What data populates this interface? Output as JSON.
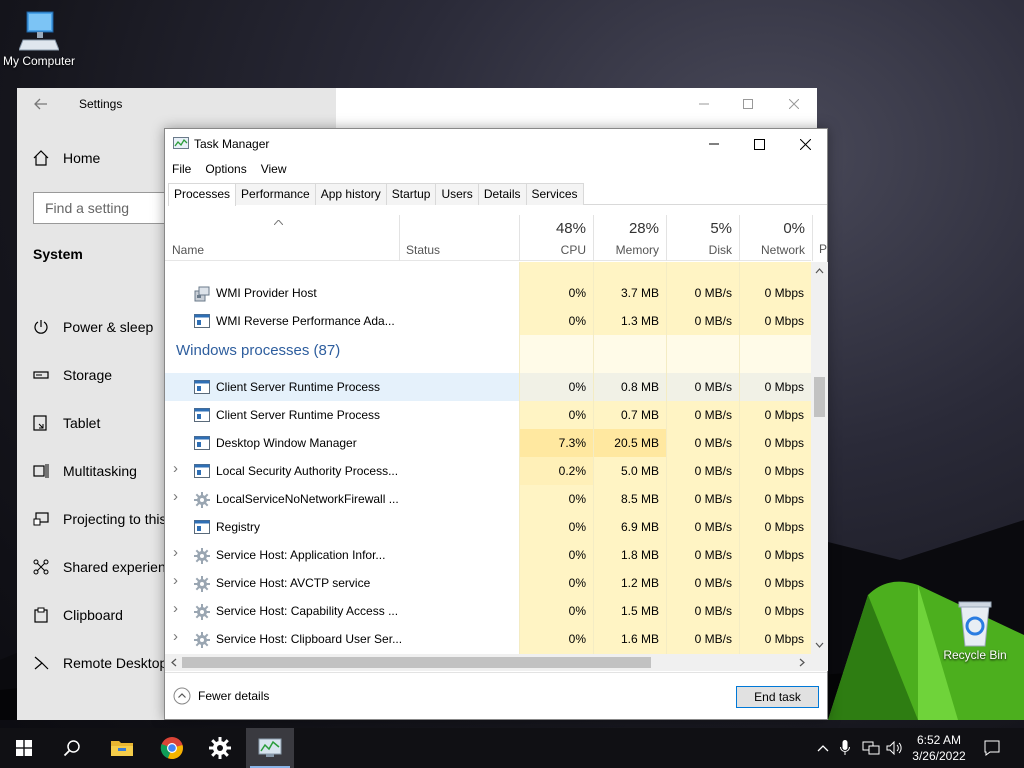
{
  "desktop": {
    "icons": [
      {
        "label": "My Computer",
        "icon": "computer-icon"
      },
      {
        "label": "Recycle Bin",
        "icon": "recycle-bin-icon"
      }
    ]
  },
  "settings": {
    "title": "Settings",
    "home": "Home",
    "search_placeholder": "Find a setting",
    "section": "System",
    "nav": [
      {
        "label": "Power & sleep",
        "icon": "power-icon"
      },
      {
        "label": "Storage",
        "icon": "storage-icon"
      },
      {
        "label": "Tablet",
        "icon": "tablet-icon"
      },
      {
        "label": "Multitasking",
        "icon": "multitasking-icon"
      },
      {
        "label": "Projecting to this PC",
        "icon": "projecting-icon"
      },
      {
        "label": "Shared experiences",
        "icon": "shared-icon"
      },
      {
        "label": "Clipboard",
        "icon": "clipboard-icon"
      },
      {
        "label": "Remote Desktop",
        "icon": "remote-desktop-icon"
      }
    ]
  },
  "task_manager": {
    "title": "Task Manager",
    "menu": [
      "File",
      "Options",
      "View"
    ],
    "tabs": [
      "Processes",
      "Performance",
      "App history",
      "Startup",
      "Users",
      "Details",
      "Services"
    ],
    "active_tab": "Processes",
    "columns": {
      "name": "Name",
      "status": "Status",
      "cpu": {
        "pct": "48%",
        "label": "CPU"
      },
      "memory": {
        "pct": "28%",
        "label": "Memory"
      },
      "disk": {
        "pct": "5%",
        "label": "Disk"
      },
      "network": {
        "pct": "0%",
        "label": "Network"
      },
      "power_partial": "P"
    },
    "group_title": "Windows processes (87)",
    "rows_top": [
      {
        "name": "WMI Provider Host",
        "cpu": "0%",
        "memory": "3.7 MB",
        "disk": "0 MB/s",
        "network": "0 Mbps",
        "expand": false,
        "icon": "wmi-icon"
      },
      {
        "name": "WMI Reverse Performance Ada...",
        "cpu": "0%",
        "memory": "1.3 MB",
        "disk": "0 MB/s",
        "network": "0 Mbps",
        "expand": false,
        "icon": "window-process-icon"
      }
    ],
    "rows": [
      {
        "name": "Client Server Runtime Process",
        "cpu": "0%",
        "memory": "0.8 MB",
        "disk": "0 MB/s",
        "network": "0 Mbps",
        "expand": false,
        "icon": "window-process-icon"
      },
      {
        "name": "Client Server Runtime Process",
        "cpu": "0%",
        "memory": "0.7 MB",
        "disk": "0 MB/s",
        "network": "0 Mbps",
        "expand": false,
        "icon": "window-process-icon"
      },
      {
        "name": "Desktop Window Manager",
        "cpu": "7.3%",
        "memory": "20.5 MB",
        "disk": "0 MB/s",
        "network": "0 Mbps",
        "expand": false,
        "icon": "window-process-icon"
      },
      {
        "name": "Local Security Authority Process...",
        "cpu": "0.2%",
        "memory": "5.0 MB",
        "disk": "0 MB/s",
        "network": "0 Mbps",
        "expand": true,
        "icon": "window-process-icon"
      },
      {
        "name": "LocalServiceNoNetworkFirewall ...",
        "cpu": "0%",
        "memory": "8.5 MB",
        "disk": "0 MB/s",
        "network": "0 Mbps",
        "expand": true,
        "icon": "gear-process-icon"
      },
      {
        "name": "Registry",
        "cpu": "0%",
        "memory": "6.9 MB",
        "disk": "0 MB/s",
        "network": "0 Mbps",
        "expand": false,
        "icon": "window-process-icon"
      },
      {
        "name": "Service Host: Application Infor...",
        "cpu": "0%",
        "memory": "1.8 MB",
        "disk": "0 MB/s",
        "network": "0 Mbps",
        "expand": true,
        "icon": "gear-process-icon"
      },
      {
        "name": "Service Host: AVCTP service",
        "cpu": "0%",
        "memory": "1.2 MB",
        "disk": "0 MB/s",
        "network": "0 Mbps",
        "expand": true,
        "icon": "gear-process-icon"
      },
      {
        "name": "Service Host: Capability Access ...",
        "cpu": "0%",
        "memory": "1.5 MB",
        "disk": "0 MB/s",
        "network": "0 Mbps",
        "expand": true,
        "icon": "gear-process-icon"
      },
      {
        "name": "Service Host: Clipboard User Ser...",
        "cpu": "0%",
        "memory": "1.6 MB",
        "disk": "0 MB/s",
        "network": "0 Mbps",
        "expand": true,
        "icon": "gear-process-icon"
      }
    ],
    "fewer_details": "Fewer details",
    "end_task": "End task"
  },
  "taskbar": {
    "items": [
      "start-icon",
      "search-icon",
      "file-explorer-icon",
      "chrome-icon",
      "settings-icon",
      "task-manager-icon"
    ],
    "tray": [
      "chevron-up-icon",
      "microphone-icon",
      "network-icon",
      "volume-icon"
    ],
    "time": "6:52 AM",
    "date": "3/26/2022",
    "notification_icon": "notification-icon"
  },
  "colors": {
    "accent": "#0078d7",
    "group_title": "#2e5e9e",
    "heat_light": "#fff4c4",
    "heat_medium": "#ffe8a0",
    "selected_row": "#e5f1fb"
  }
}
